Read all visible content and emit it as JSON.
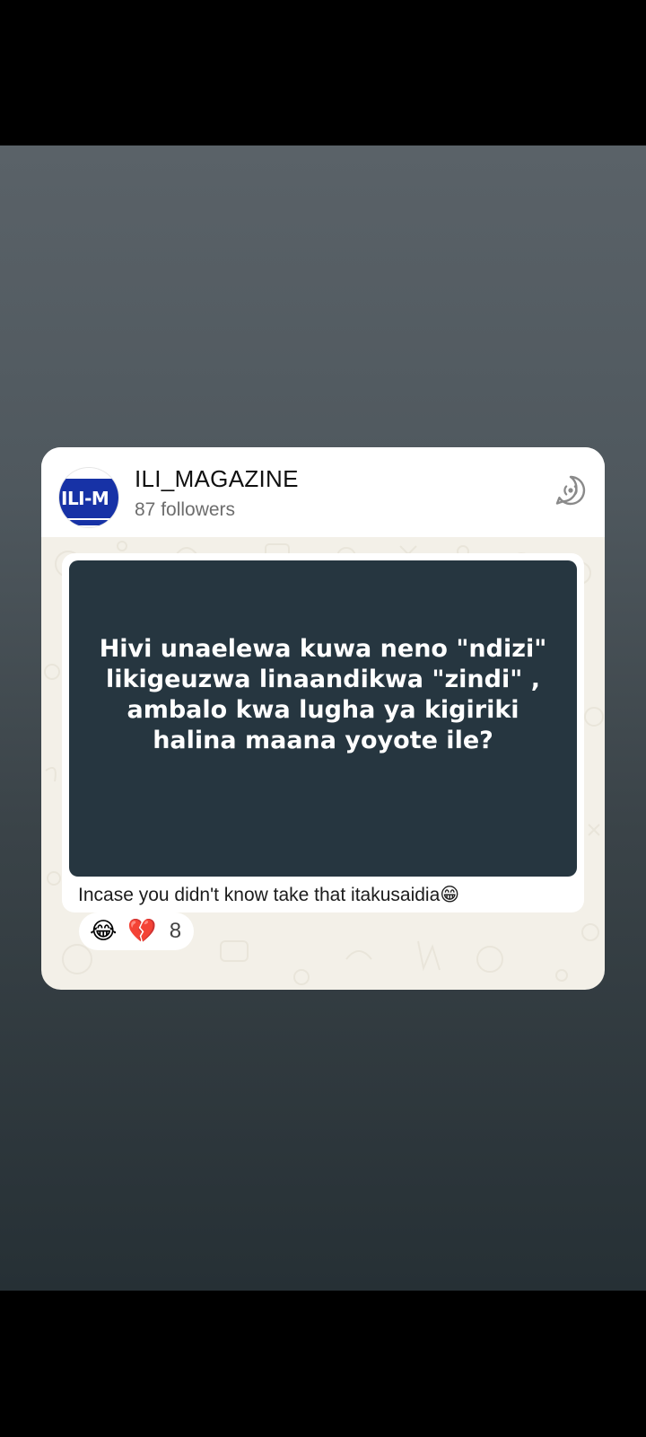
{
  "channel": {
    "name": "ILI_MAGAZINE",
    "followers": "87 followers",
    "avatar_text": "ILI-M"
  },
  "post": {
    "image_text": "Hivi unaelewa kuwa neno \"ndizi\" likigeuzwa linaandikwa \"zindi\" , ambalo kwa lugha ya kigiriki halina maana yoyote ile?",
    "caption": "Incase you didn't know take that itakusaidia😁"
  },
  "reactions": {
    "emojis": [
      "😂",
      "💔"
    ],
    "count": "8"
  },
  "icons": {
    "channel_icon": "channel-broadcast-icon"
  },
  "colors": {
    "avatar_blue": "#1732a6",
    "media_bg": "#263640",
    "card_bg": "#f3f0e8"
  }
}
